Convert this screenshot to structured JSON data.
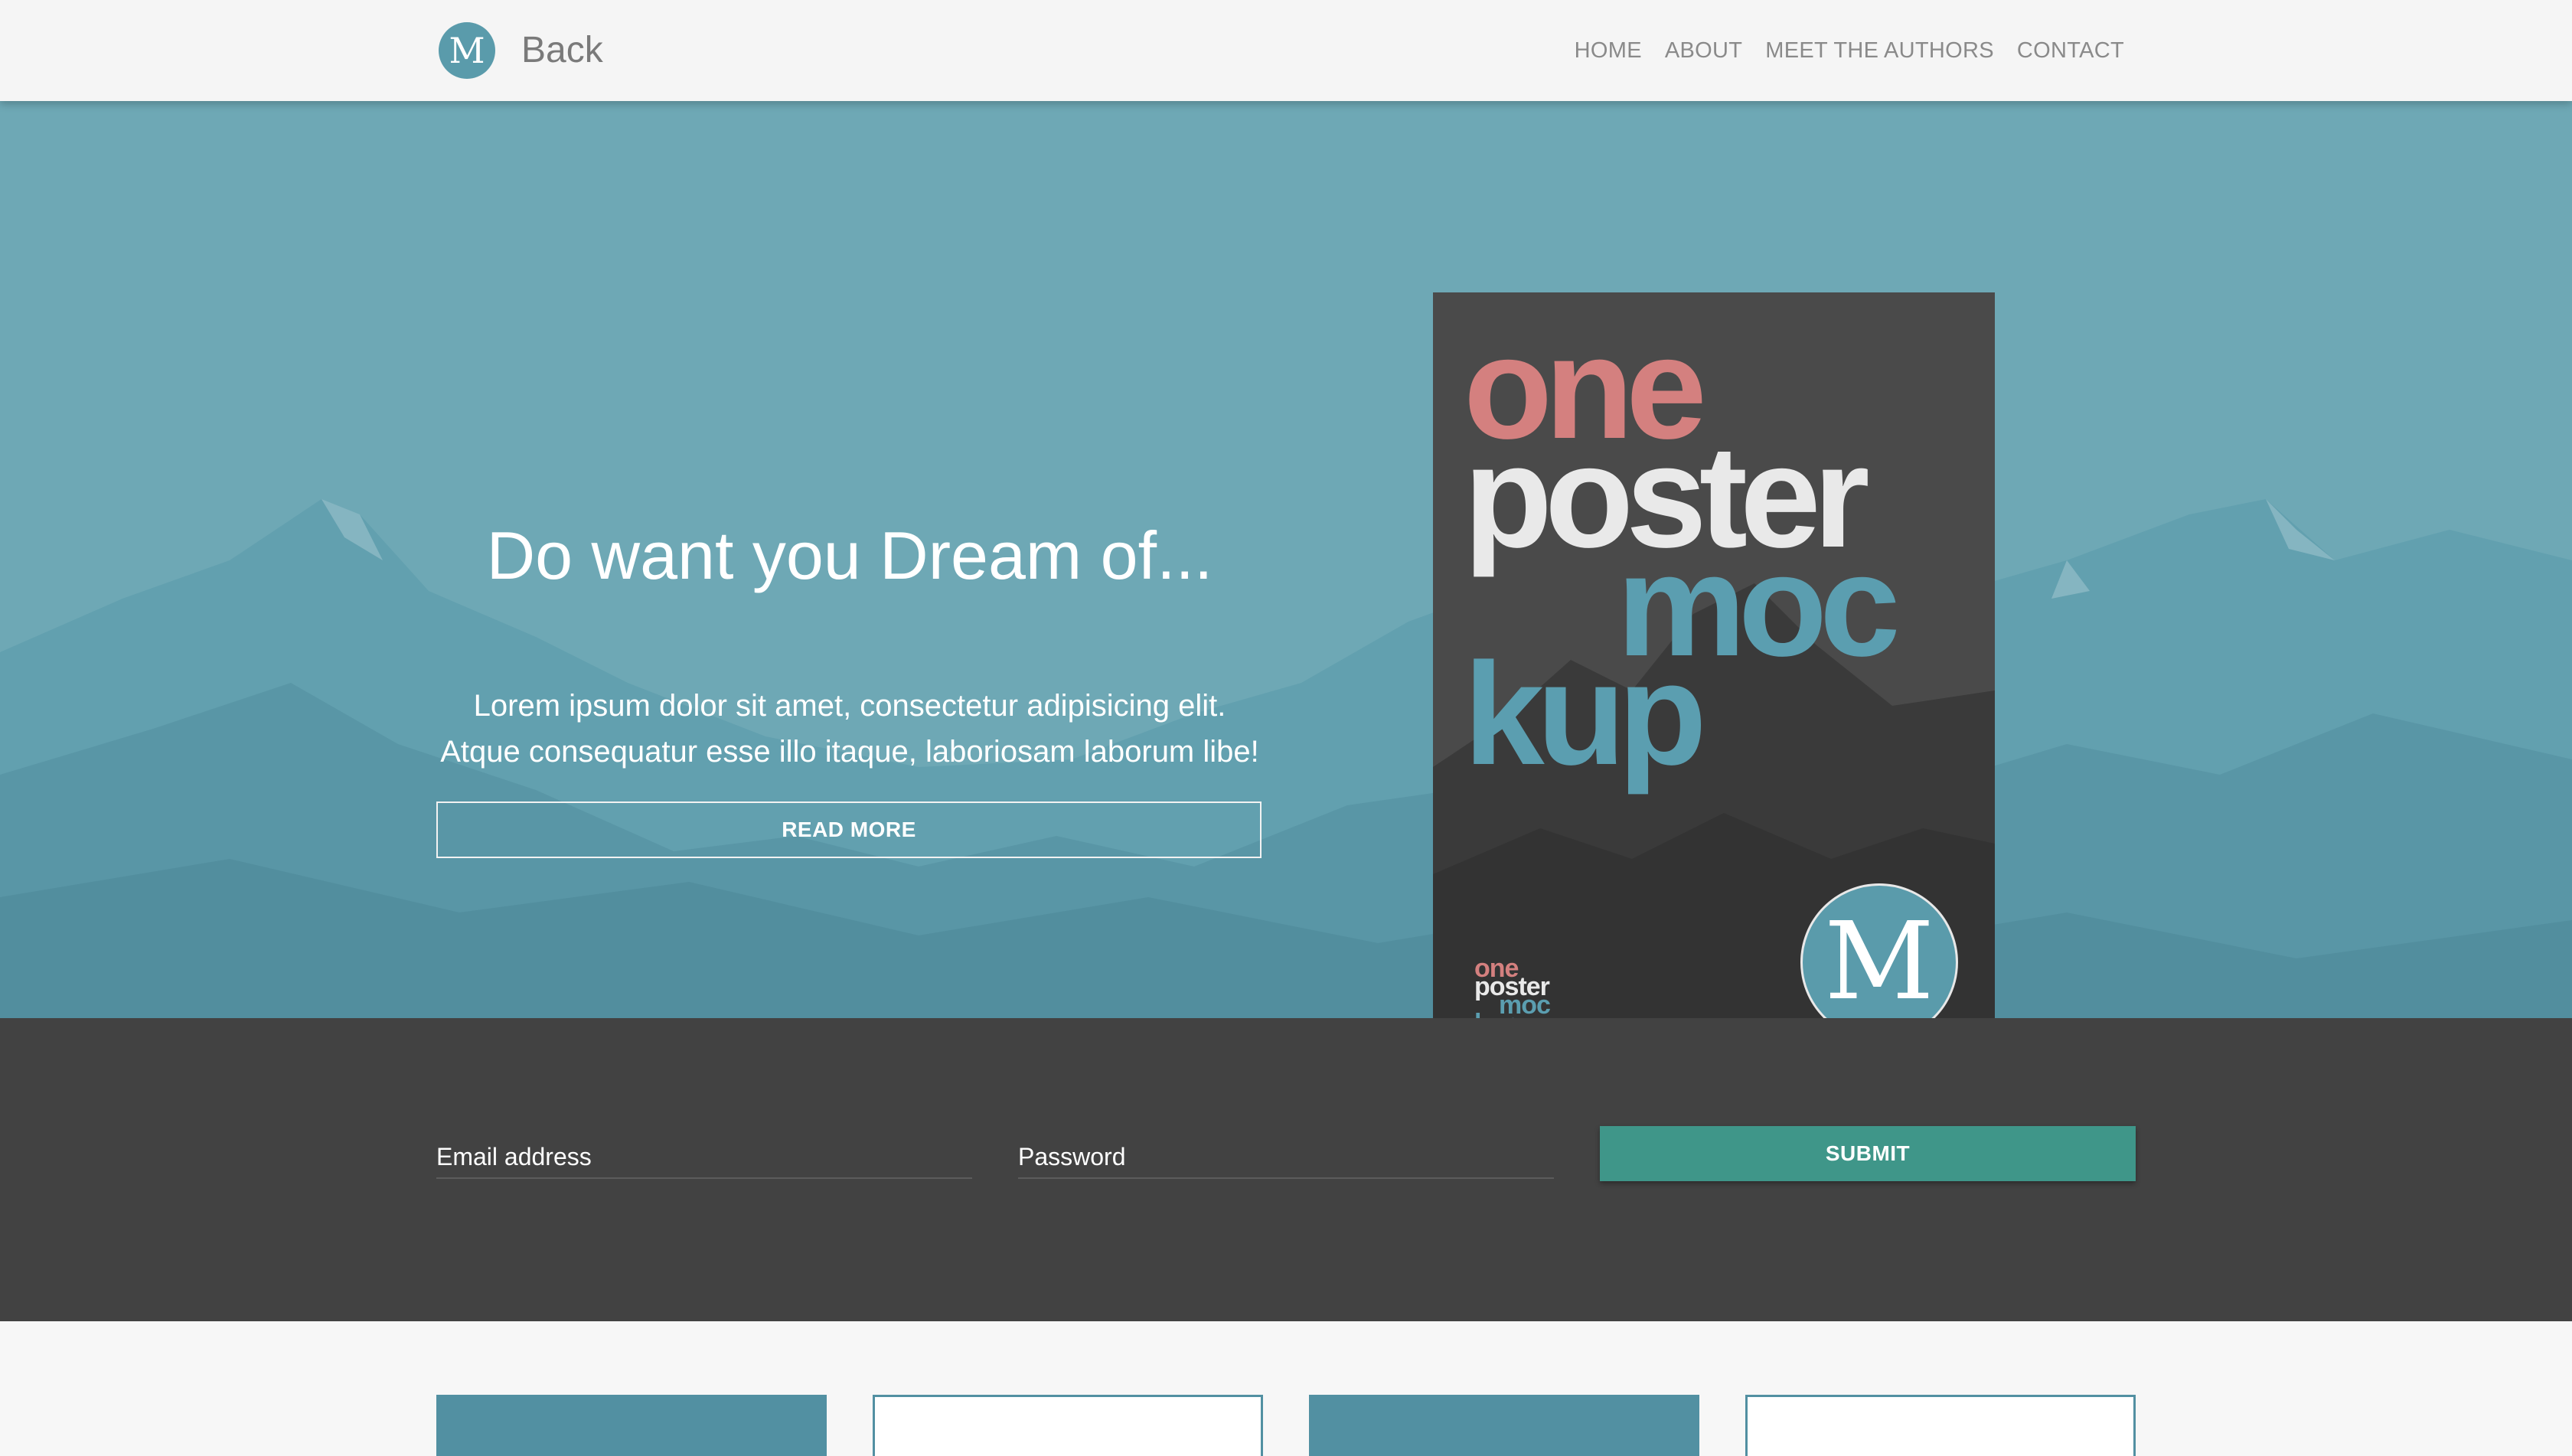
{
  "navbar": {
    "logo_letter": "M",
    "brand": "Back",
    "links": [
      "HOME",
      "ABOUT",
      "MEET THE AUTHORS",
      "CONTACT"
    ]
  },
  "hero": {
    "title": "Do want you Dream of...",
    "text_line1": "Lorem ipsum dolor sit amet, consectetur adipisicing elit.",
    "text_line2": "Atque consequatur esse illo itaque, laboriosam laborum libe!",
    "button_label": "READ MORE",
    "poster": {
      "words": [
        "one",
        "poster",
        "moc",
        "kup"
      ],
      "logo_letter": "M"
    }
  },
  "form": {
    "email_label": "Email address",
    "password_label": "Password",
    "submit_label": "SUBMIT"
  },
  "colors": {
    "accent": "#5a9bab",
    "hero_bg": "#6ea8b5",
    "dark_band": "#424242",
    "submit": "#3f9689",
    "poster_bg": "#4a4a4a",
    "poster_pink": "#d4807f",
    "poster_white": "#e9e9e9",
    "poster_teal": "#5b9eb0"
  },
  "icons": {
    "brand": "m-circle-logo",
    "poster_logo": "m-circle-logo"
  }
}
